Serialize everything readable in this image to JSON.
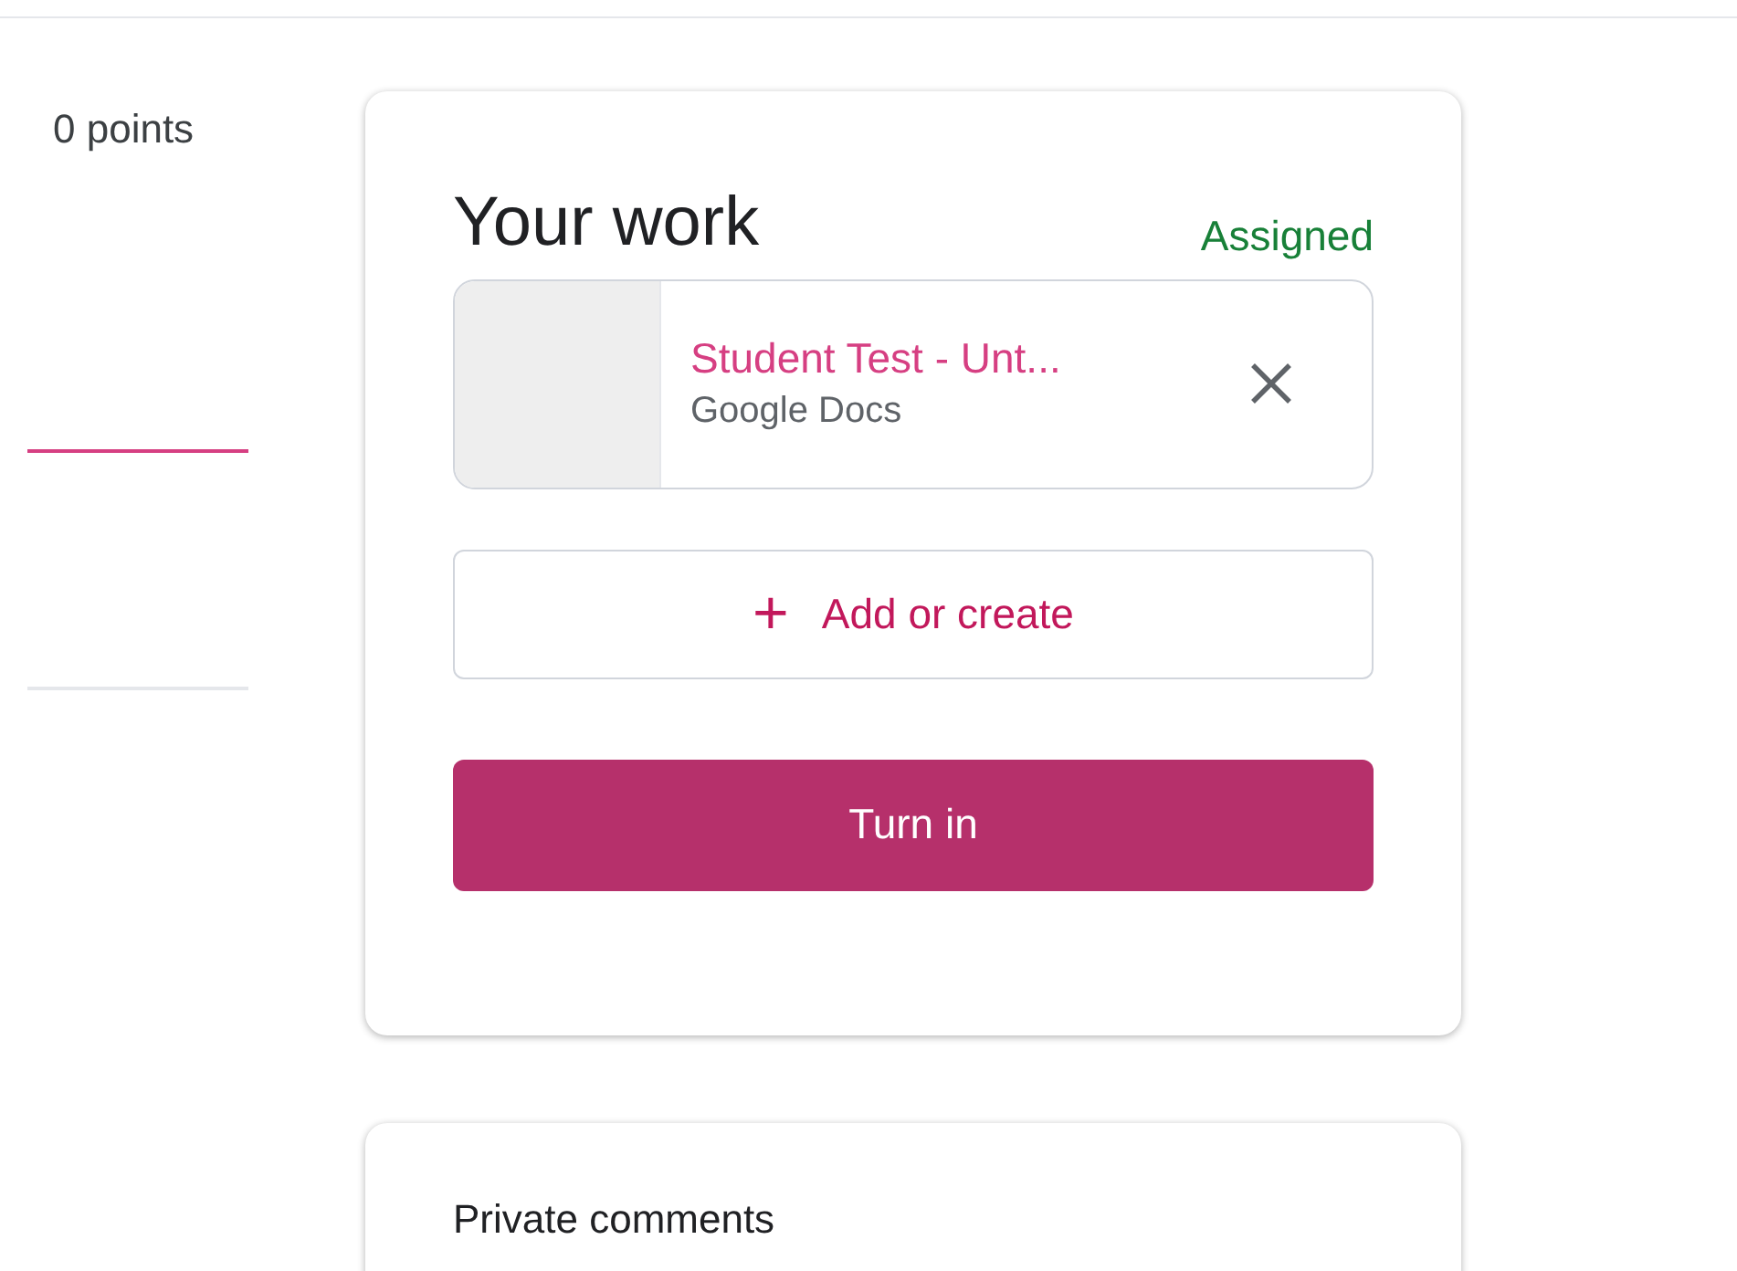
{
  "points": "0 points",
  "your_work": {
    "title": "Your work",
    "status": "Assigned",
    "attachments": [
      {
        "title": "Student Test - Unt...",
        "type": "Google Docs"
      }
    ],
    "add_button": {
      "icon": "+",
      "label": "Add or create"
    },
    "turn_in_button": {
      "label": "Turn in"
    }
  },
  "private_comments": {
    "title": "Private comments"
  }
}
